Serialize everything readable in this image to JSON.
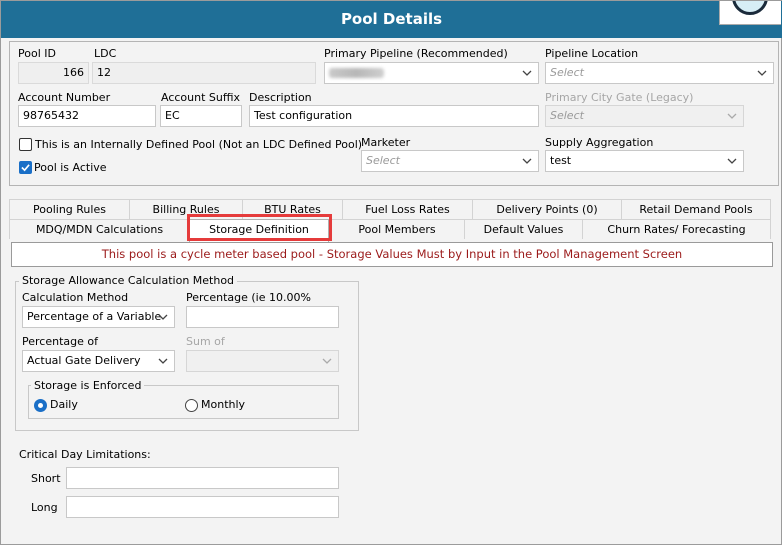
{
  "window": {
    "title": "Pool Details"
  },
  "pool": {
    "pool_id_label": "Pool ID",
    "pool_id": "166",
    "ldc_label": "LDC",
    "ldc": "12",
    "primary_pipeline_label": "Primary Pipeline (Recommended)",
    "pipeline_location_label": "Pipeline Location",
    "pipeline_location_placeholder": "Select",
    "account_number_label": "Account Number",
    "account_number": "98765432",
    "account_suffix_label": "Account Suffix",
    "account_suffix": "EC",
    "description_label": "Description",
    "description": "Test configuration",
    "primary_city_gate_label": "Primary City Gate (Legacy)",
    "primary_city_gate_placeholder": "Select",
    "internally_defined_label": "This is an Internally Defined Pool (Not an LDC Defined Pool)",
    "internally_defined_checked": false,
    "pool_active_label": "Pool is Active",
    "pool_active_checked": true,
    "marketer_label": "Marketer",
    "marketer_placeholder": "Select",
    "supply_aggregation_label": "Supply Aggregation",
    "supply_aggregation": "test"
  },
  "tabs_row1": [
    "Pooling Rules",
    "Billing Rules",
    "BTU Rates",
    "Fuel Loss Rates",
    "Delivery Points (0)",
    "Retail Demand Pools"
  ],
  "tabs_row2": [
    "MDQ/MDN Calculations",
    "Storage Definition",
    "Pool Members",
    "Default Values",
    "Churn Rates/ Forecasting"
  ],
  "active_tab": "Storage Definition",
  "banner": "This pool is a cycle meter based pool - Storage Values Must by Input in the Pool Management Screen",
  "storage": {
    "group_title": "Storage Allowance Calculation Method",
    "calc_method_label": "Calculation Method",
    "calc_method_value": "Percentage of a Variable",
    "percentage_label": "Percentage (ie 10.00%",
    "percentage_value": "",
    "percentage_of_label": "Percentage of",
    "percentage_of_value": "Actual Gate Delivery",
    "sum_of_label": "Sum of",
    "sum_of_value": "",
    "enforced_title": "Storage is Enforced",
    "daily_label": "Daily",
    "monthly_label": "Monthly",
    "enforced_selected": "Daily"
  },
  "critical": {
    "title": "Critical Day Limitations:",
    "short_label": "Short",
    "short_value": "",
    "long_label": "Long",
    "long_value": ""
  },
  "colors": {
    "titlebar": "#1f6f97",
    "banner_text": "#9b1a1a",
    "highlight": "#e53b3b",
    "check_blue": "#1a6fc7"
  }
}
